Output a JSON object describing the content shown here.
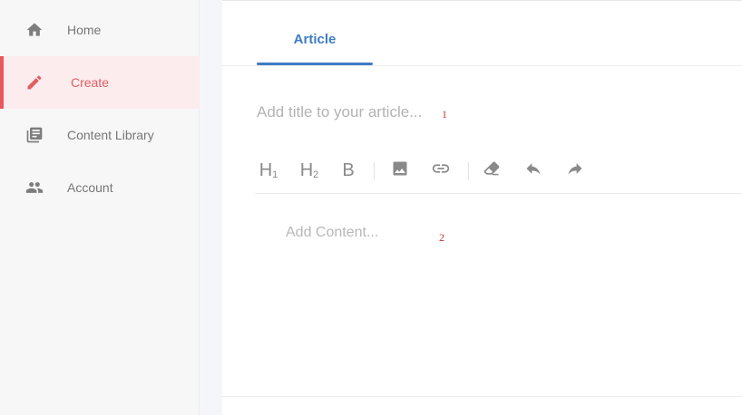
{
  "sidebar": {
    "items": [
      {
        "label": "Home",
        "icon": "home-icon",
        "active": false
      },
      {
        "label": "Create",
        "icon": "pencil-icon",
        "active": true
      },
      {
        "label": "Content Library",
        "icon": "library-icon",
        "active": false
      },
      {
        "label": "Account",
        "icon": "people-icon",
        "active": false
      }
    ]
  },
  "editor": {
    "tabs": [
      {
        "label": "Article",
        "active": true
      }
    ],
    "title_placeholder": "Add title to your article...",
    "title_marker": "1",
    "content_placeholder": "Add Content...",
    "content_marker": "2",
    "toolbar": {
      "h1_label": "H",
      "h1_sub": "1",
      "h2_label": "H",
      "h2_sub": "2",
      "bold_label": "B",
      "icons": [
        "image-icon",
        "link-icon",
        "eraser-icon",
        "undo-icon",
        "redo-icon"
      ]
    }
  },
  "colors": {
    "accent": "#3f7cc6",
    "active_nav": "#e25f63",
    "active_nav_bg": "#fdecee",
    "marker": "#c0392b"
  }
}
